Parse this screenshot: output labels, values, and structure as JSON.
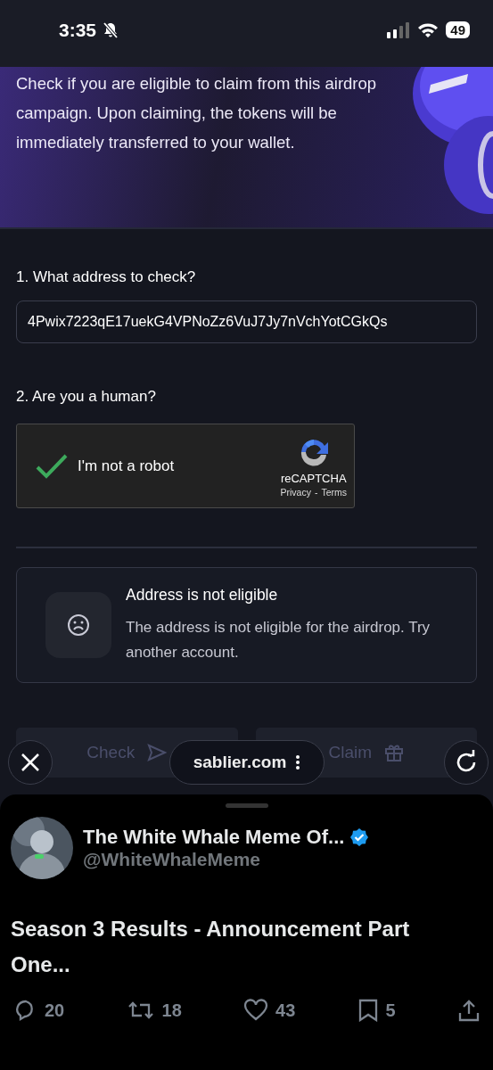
{
  "status_bar": {
    "time": "3:35",
    "silent": true,
    "battery": "49"
  },
  "hero": {
    "description": "Check if you are eligible to claim from this airdrop campaign. Upon claiming, the tokens will be immediately transferred to your wallet."
  },
  "form": {
    "address_label": "1. What address to check?",
    "address_value": "4Pwix7223qE17uekG4VPNoZz6VuJ7Jy7nVchYotCGkQs",
    "human_label": "2. Are you a human?",
    "captcha": {
      "checked": true,
      "label": "I'm not a robot",
      "brand": "reCAPTCHA",
      "privacy": "Privacy",
      "separator": "-",
      "terms": "Terms"
    }
  },
  "result": {
    "title": "Address is not eligible",
    "message": "The address is not eligible for the airdrop. Try another account."
  },
  "actions": [
    {
      "kind": "check",
      "label": "Check",
      "disabled": true
    },
    {
      "kind": "claim",
      "label": "Claim",
      "disabled": true
    }
  ],
  "browser_bar": {
    "url": "sablier.com"
  },
  "post": {
    "author": "The White Whale Meme Of...",
    "verified": true,
    "handle": "@WhiteWhaleMeme",
    "title": "Season 3 Results - Announcement Part One...",
    "stats": [
      {
        "kind": "reply",
        "count": "20"
      },
      {
        "kind": "repost",
        "count": "18"
      },
      {
        "kind": "like",
        "count": "43"
      },
      {
        "kind": "bookmark",
        "count": "5"
      },
      {
        "kind": "share"
      }
    ]
  }
}
